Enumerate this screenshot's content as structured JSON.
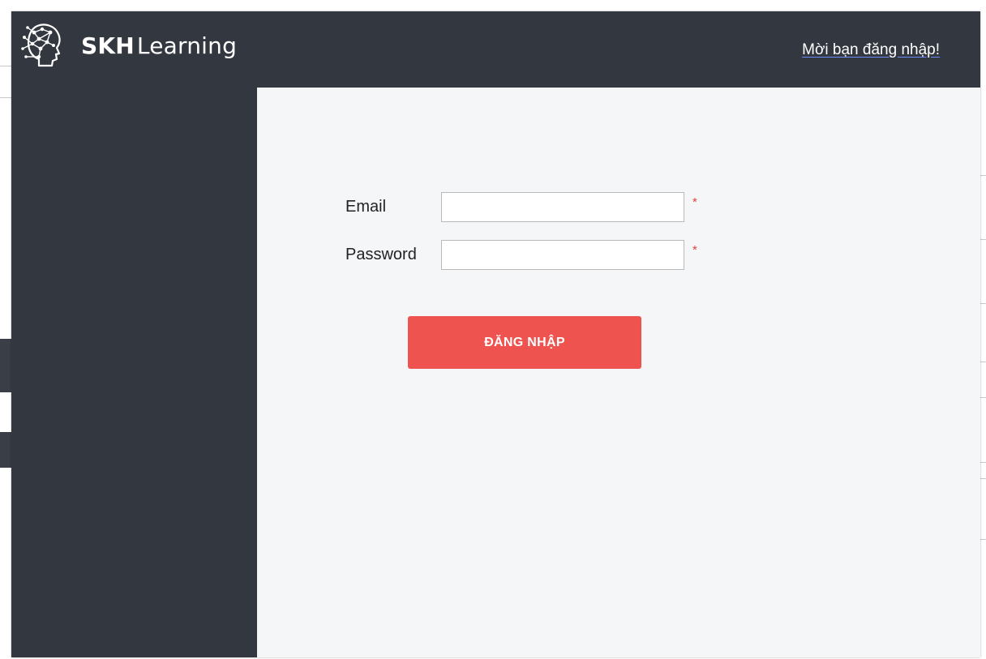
{
  "header": {
    "brand_bold": "SKH",
    "brand_rest": "Learning",
    "login_prompt_link": "Mời bạn đăng nhập!"
  },
  "login_form": {
    "email_label": "Email",
    "email_value": "",
    "password_label": "Password",
    "password_value": "",
    "required_marker": "*",
    "submit_label": "ĐĂNG NHẬP"
  },
  "colors": {
    "dark_panel": "#33373f",
    "content_background": "#f4f6f8",
    "button_red": "#ef5350",
    "required_red": "#e0423e"
  },
  "icons": {
    "logo": "brain-head-logo-icon"
  }
}
